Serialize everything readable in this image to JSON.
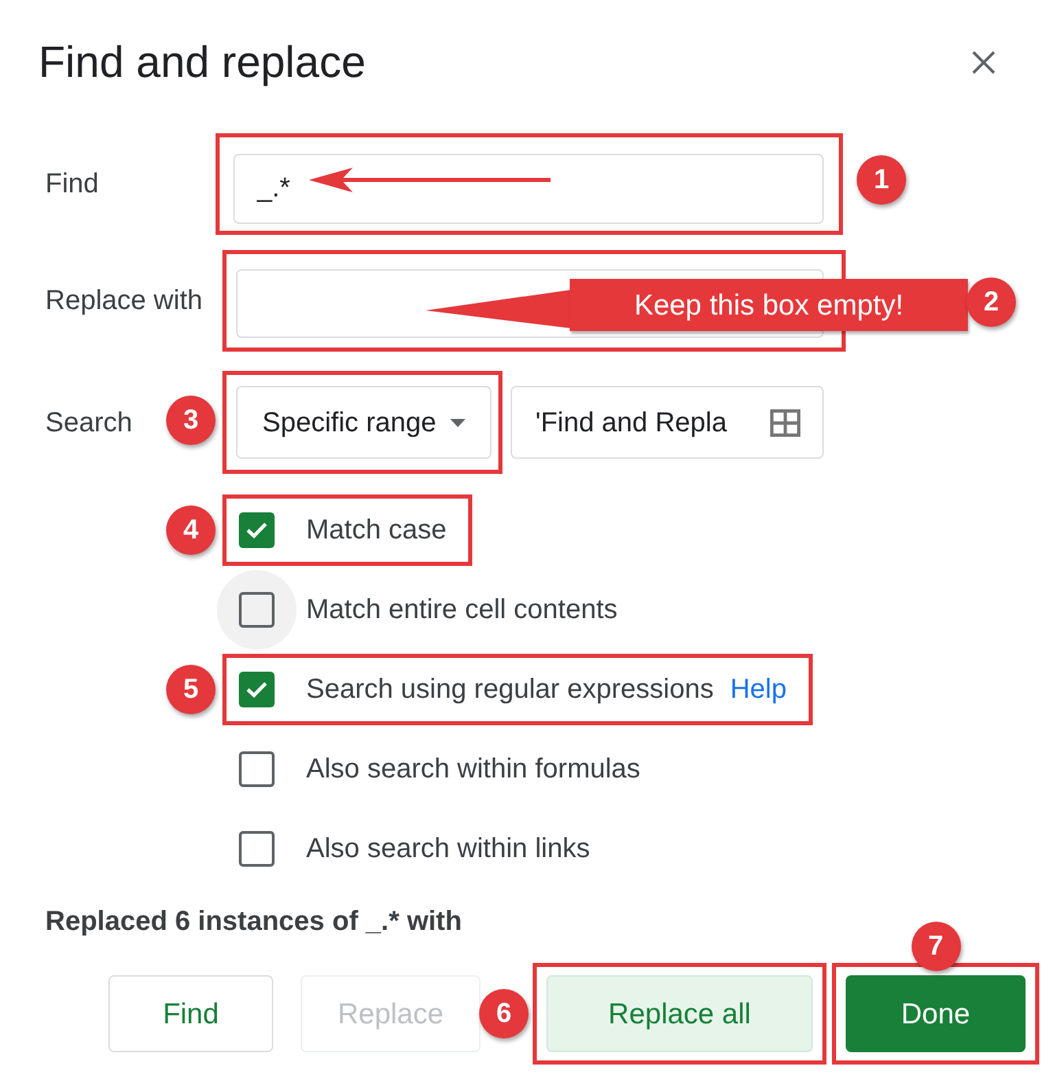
{
  "title": "Find and replace",
  "find": {
    "label": "Find",
    "value": "_.*",
    "badge": "1",
    "annotation_arrow": true
  },
  "replace_with": {
    "label": "Replace with",
    "badge": "2",
    "callout": "Keep this box empty!"
  },
  "search": {
    "label": "Search",
    "badge": "3",
    "scope": "Specific range",
    "range": "'Find and Repla"
  },
  "options": [
    {
      "label": "Match case",
      "checked": true,
      "hovered": false,
      "badge": "4"
    },
    {
      "label": "Match entire cell contents",
      "checked": false,
      "hovered": true
    },
    {
      "label": "Search using regular expressions",
      "checked": true,
      "hovered": false,
      "badge": "5",
      "link": "Help"
    },
    {
      "label": "Also search within formulas",
      "checked": false,
      "hovered": false
    },
    {
      "label": "Also search within links",
      "checked": false,
      "hovered": false
    }
  ],
  "status": "Replaced 6 instances of _.* with",
  "buttons": [
    {
      "label": "Find",
      "kind": "outline",
      "disabled": false
    },
    {
      "label": "Replace",
      "kind": "outline",
      "disabled": true
    },
    {
      "label": "Replace all",
      "kind": "tonal",
      "disabled": false,
      "badge": "6",
      "badge_above": false
    },
    {
      "label": "Done",
      "kind": "filled",
      "disabled": false,
      "badge": "7",
      "badge_above": true
    }
  ]
}
